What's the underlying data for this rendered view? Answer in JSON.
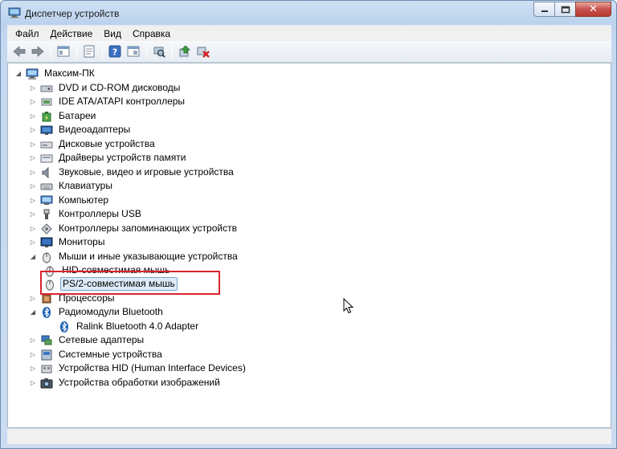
{
  "window": {
    "title": "Диспетчер устройств",
    "caption_buttons": {
      "minimize": "—",
      "maximize": "▢",
      "close": "✕"
    }
  },
  "menu": [
    "Файл",
    "Действие",
    "Вид",
    "Справка"
  ],
  "toolbar": {
    "buttons": [
      "back-arrow-icon",
      "forward-arrow-icon",
      "show-hide-tree-icon",
      "properties-icon",
      "help-icon",
      "view-icon",
      "scan-hardware-icon",
      "update-driver-icon",
      "uninstall-icon"
    ]
  },
  "tree": {
    "root": "Максим-ПК",
    "items": [
      {
        "label": "DVD и CD-ROM дисководы",
        "icon": "disc-drive-icon"
      },
      {
        "label": "IDE ATA/ATAPI контроллеры",
        "icon": "ide-controller-icon"
      },
      {
        "label": "Батареи",
        "icon": "battery-icon"
      },
      {
        "label": "Видеоадаптеры",
        "icon": "display-adapter-icon"
      },
      {
        "label": "Дисковые устройства",
        "icon": "hard-disk-icon"
      },
      {
        "label": "Драйверы устройств памяти",
        "icon": "memory-driver-icon"
      },
      {
        "label": "Звуковые, видео и игровые устройства",
        "icon": "speaker-icon"
      },
      {
        "label": "Клавиатуры",
        "icon": "keyboard-icon"
      },
      {
        "label": "Компьютер",
        "icon": "computer-icon"
      },
      {
        "label": "Контроллеры USB",
        "icon": "usb-icon"
      },
      {
        "label": "Контроллеры запоминающих устройств",
        "icon": "storage-controller-icon"
      },
      {
        "label": "Мониторы",
        "icon": "monitor-icon"
      },
      {
        "label": "Мыши и иные указывающие устройства",
        "icon": "mouse-icon",
        "expanded": true,
        "children": [
          "HID-совместимая мышь",
          "PS/2-совместимая мышь"
        ]
      },
      {
        "label": "Процессоры",
        "icon": "processor-icon"
      },
      {
        "label": "Радиомодули Bluetooth",
        "icon": "bluetooth-icon",
        "expanded": true,
        "children": [
          "Ralink Bluetooth 4.0 Adapter"
        ]
      },
      {
        "label": "Сетевые адаптеры",
        "icon": "network-adapter-icon"
      },
      {
        "label": "Системные устройства",
        "icon": "system-devices-icon"
      },
      {
        "label": "Устройства HID (Human Interface Devices)",
        "icon": "hid-icon"
      },
      {
        "label": "Устройства обработки изображений",
        "icon": "imaging-device-icon"
      }
    ],
    "selected": "PS/2-совместимая мышь"
  },
  "colors": {
    "highlight": "#d9242c",
    "selection_bg": "#dceaf8",
    "selection_border": "#7da2ce"
  }
}
